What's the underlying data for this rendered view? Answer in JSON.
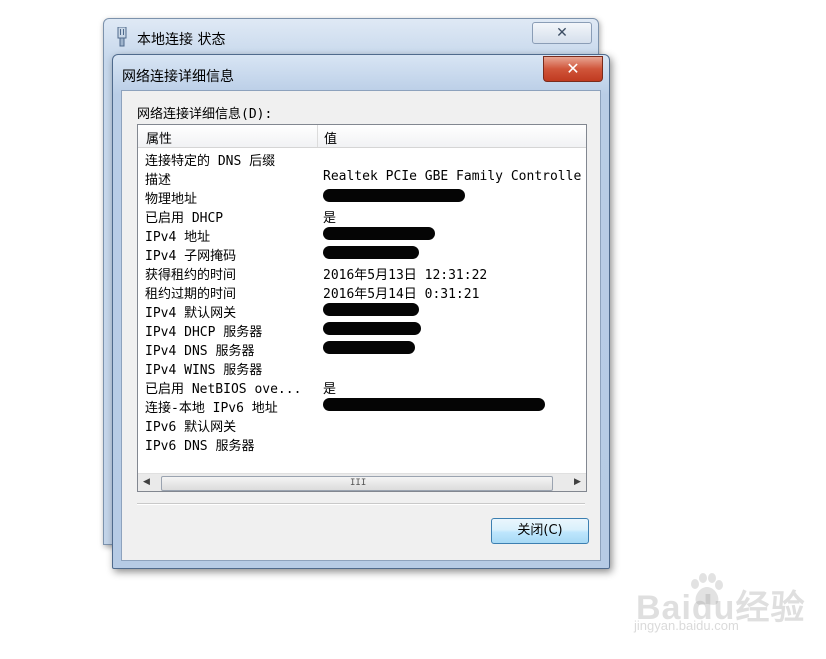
{
  "back_window": {
    "title": "本地连接 状态",
    "close_label": "✕",
    "icon": "network-adapter-icon"
  },
  "front_window": {
    "title": "网络连接详细信息",
    "close_label": "✕",
    "list_caption": "网络连接详细信息(D):",
    "columns": [
      "属性",
      "值"
    ],
    "rows": [
      {
        "prop": "连接特定的 DNS 后缀",
        "value": ""
      },
      {
        "prop": "描述",
        "value": "Realtek PCIe GBE Family Controlle"
      },
      {
        "prop": "物理地址",
        "value": ""
      },
      {
        "prop": "已启用 DHCP",
        "value": "是"
      },
      {
        "prop": "IPv4 地址",
        "value": ""
      },
      {
        "prop": "IPv4 子网掩码",
        "value": ""
      },
      {
        "prop": "获得租约的时间",
        "value": "2016年5月13日 12:31:22"
      },
      {
        "prop": "租约过期的时间",
        "value": "2016年5月14日 0:31:21"
      },
      {
        "prop": "IPv4 默认网关",
        "value": ""
      },
      {
        "prop": "IPv4 DHCP 服务器",
        "value": ""
      },
      {
        "prop": "IPv4 DNS 服务器",
        "value": ""
      },
      {
        "prop": "IPv4 WINS 服务器",
        "value": ""
      },
      {
        "prop": "已启用 NetBIOS ove...",
        "value": "是"
      },
      {
        "prop": "连接-本地 IPv6 地址",
        "value": ""
      },
      {
        "prop": "IPv6 默认网关",
        "value": ""
      },
      {
        "prop": "IPv6 DNS 服务器",
        "value": ""
      }
    ],
    "scroll_left": "◀",
    "scroll_right": "▶",
    "scroll_grip": "III",
    "close_button": "关闭(C)"
  },
  "watermark": {
    "text": "Baidu经验",
    "url": "jingyan.baidu.com"
  },
  "colors": {
    "title_bar": "#b9cde6",
    "close_red": "#c03a20",
    "button_blue": "#bee6fd",
    "redaction": "#050505"
  }
}
